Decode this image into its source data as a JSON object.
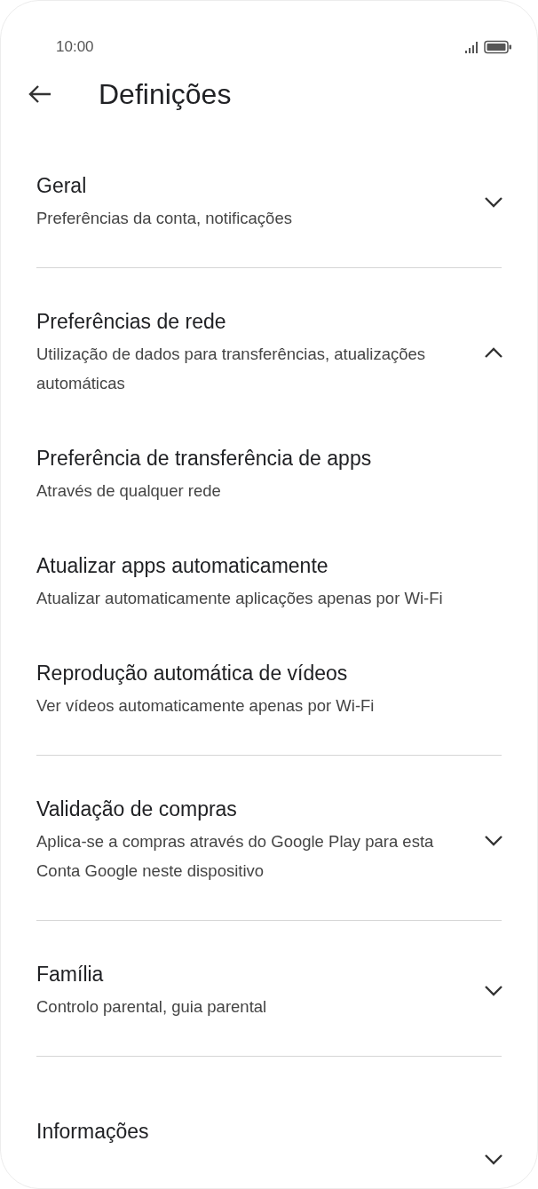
{
  "status_bar": {
    "time": "10:00"
  },
  "app_bar": {
    "title": "Definições"
  },
  "sections": [
    {
      "title": "Geral",
      "subtitle": "Preferências da conta, notificações",
      "expanded": false
    },
    {
      "title": "Preferências de rede",
      "subtitle": "Utilização de dados para transferências, atualizações automáticas",
      "expanded": true,
      "children": [
        {
          "title": "Preferência de transferência de apps",
          "subtitle": "Através de qualquer rede"
        },
        {
          "title": "Atualizar apps automaticamente",
          "subtitle": "Atualizar automaticamente aplicações apenas por Wi-Fi"
        },
        {
          "title": "Reprodução automática de vídeos",
          "subtitle": "Ver vídeos automaticamente apenas por Wi-Fi"
        }
      ]
    },
    {
      "title": "Validação de compras",
      "subtitle": "Aplica-se a compras através do Google Play para esta Conta Google neste dispositivo",
      "expanded": false
    },
    {
      "title": "Família",
      "subtitle": "Controlo parental, guia parental",
      "expanded": false
    },
    {
      "title": "Informações",
      "expanded": false
    }
  ]
}
